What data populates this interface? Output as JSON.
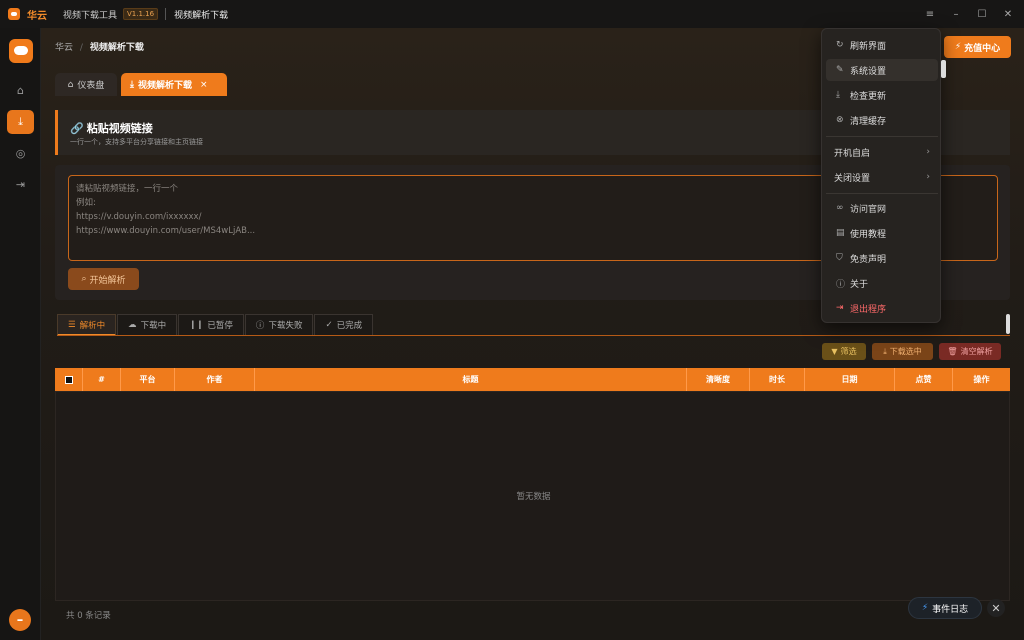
{
  "titlebar": {
    "brand": "华云",
    "app_name": "视频下载工具",
    "version": "V1.1.16",
    "page": "视频解析下载"
  },
  "breadcrumb": {
    "root": "华云",
    "sep": "/",
    "current": "视频解析下载"
  },
  "tabs": [
    {
      "label": "仪表盘",
      "icon": "home-icon"
    },
    {
      "label": "视频解析下载",
      "icon": "download-icon",
      "close": "×"
    }
  ],
  "recharge_label": "充值中心",
  "section": {
    "title": "粘贴视频链接",
    "subtitle": "一行一个，支持多平台分享链接和主页链接"
  },
  "input": {
    "placeholder": "请粘贴视频链接，一行一个\n例如:\nhttps://v.douyin.com/ixxxxxx/\nhttps://www.douyin.com/user/MS4wLjAB..."
  },
  "parse_button": "开始解析",
  "filters": [
    {
      "label": "解析中",
      "icon": "list-icon"
    },
    {
      "label": "下载中",
      "icon": "cloud-download-icon"
    },
    {
      "label": "已暂停",
      "icon": "pause-icon"
    },
    {
      "label": "下载失败",
      "icon": "alert-icon"
    },
    {
      "label": "已完成",
      "icon": "check-circle-icon"
    }
  ],
  "actions": {
    "filter": "筛选",
    "download_selected": "下载选中",
    "clear": "清空解析"
  },
  "table": {
    "headers": [
      "#",
      "平台",
      "作者",
      "标题",
      "清晰度",
      "时长",
      "日期",
      "点赞",
      "操作"
    ],
    "empty": "暂无数据",
    "footer": "共 0 条记录"
  },
  "event_log": "事件日志",
  "menu": [
    {
      "label": "刷新界面",
      "icon": "refresh-icon"
    },
    {
      "label": "系统设置",
      "icon": "brush-icon"
    },
    {
      "label": "检查更新",
      "icon": "download-icon"
    },
    {
      "label": "清理缓存",
      "icon": "clear-icon"
    },
    {
      "label": "开机自启",
      "arrow": "›"
    },
    {
      "label": "关闭设置",
      "arrow": "›"
    },
    {
      "label": "访问官网",
      "icon": "link-icon"
    },
    {
      "label": "使用教程",
      "icon": "book-icon"
    },
    {
      "label": "免责声明",
      "icon": "shield-icon"
    },
    {
      "label": "关于",
      "icon": "info-icon"
    },
    {
      "label": "退出程序",
      "icon": "exit-icon"
    }
  ],
  "colors": {
    "accent": "#ef7b1c",
    "background": "#141312",
    "danger": "#ff6a6a"
  }
}
